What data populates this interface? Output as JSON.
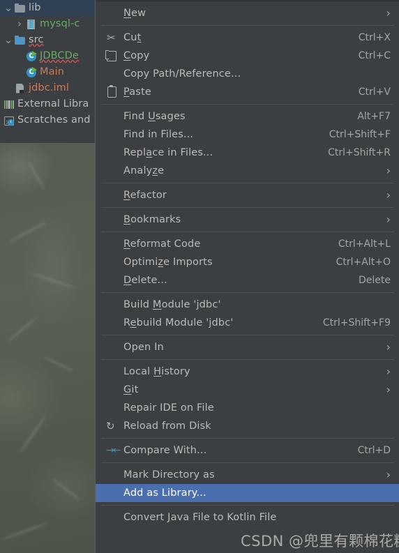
{
  "colors": {
    "menu_bg": "#3c3f41",
    "menu_text": "#bbbbbb",
    "highlight": "#4b6eaf",
    "tree_selection": "#2f4153",
    "separator": "#4e5254",
    "accent_blue": "#3592c4",
    "run_green": "#62b543",
    "error_red": "#c75450"
  },
  "tree": {
    "items": [
      {
        "label": "lib",
        "icon": "folder-gray-icon",
        "arrow": "chevron-down",
        "indent": 0,
        "selected": true,
        "color": "#bbbbbb",
        "wavy": false
      },
      {
        "label": "mysql-c",
        "icon": "jar-icon",
        "arrow": "chevron-right",
        "indent": 1,
        "selected": false,
        "color": "#6aaa64",
        "wavy": false
      },
      {
        "label": "src",
        "icon": "folder-blue-icon",
        "arrow": "chevron-down",
        "indent": 0,
        "selected": false,
        "color": "#bbbbbb",
        "wavy": true
      },
      {
        "label": "JDBCDe",
        "icon": "java-class-run-icon",
        "arrow": "none",
        "indent": 1,
        "selected": false,
        "color": "#6aaa64",
        "wavy": true
      },
      {
        "label": "Main",
        "icon": "java-class-run-icon",
        "arrow": "none",
        "indent": 1,
        "selected": false,
        "color": "#c87b5a",
        "wavy": false
      },
      {
        "label": "jdbc.iml",
        "icon": "iml-file-icon",
        "arrow": "none",
        "indent": 0,
        "selected": false,
        "color": "#c87b5a",
        "wavy": false
      },
      {
        "label": "External Libra",
        "icon": "external-libraries-icon",
        "arrow": "none",
        "indent": -1,
        "selected": false,
        "color": "#bbbbbb",
        "wavy": false
      },
      {
        "label": "Scratches and",
        "icon": "scratches-icon",
        "arrow": "none",
        "indent": -1,
        "selected": false,
        "color": "#bbbbbb",
        "wavy": false
      }
    ]
  },
  "context_menu": {
    "groups": [
      {
        "items": [
          {
            "label": "New",
            "mnemonic": "N",
            "shortcut": "",
            "submenu": true,
            "icon": "",
            "highlighted": false
          }
        ]
      },
      {
        "items": [
          {
            "label": "Cut",
            "mnemonic": "t",
            "shortcut": "Ctrl+X",
            "submenu": false,
            "icon": "cut-icon",
            "highlighted": false
          },
          {
            "label": "Copy",
            "mnemonic": "C",
            "shortcut": "Ctrl+C",
            "submenu": false,
            "icon": "copy-icon",
            "highlighted": false
          },
          {
            "label": "Copy Path/Reference...",
            "mnemonic": "",
            "shortcut": "",
            "submenu": false,
            "icon": "",
            "highlighted": false
          },
          {
            "label": "Paste",
            "mnemonic": "P",
            "shortcut": "Ctrl+V",
            "submenu": false,
            "icon": "paste-icon",
            "highlighted": false
          }
        ]
      },
      {
        "items": [
          {
            "label": "Find Usages",
            "mnemonic": "U",
            "shortcut": "Alt+F7",
            "submenu": false,
            "icon": "",
            "highlighted": false
          },
          {
            "label": "Find in Files...",
            "mnemonic": "",
            "shortcut": "Ctrl+Shift+F",
            "submenu": false,
            "icon": "",
            "highlighted": false
          },
          {
            "label": "Replace in Files...",
            "mnemonic": "a",
            "shortcut": "Ctrl+Shift+R",
            "submenu": false,
            "icon": "",
            "highlighted": false
          },
          {
            "label": "Analyze",
            "mnemonic": "z",
            "shortcut": "",
            "submenu": true,
            "icon": "",
            "highlighted": false
          }
        ]
      },
      {
        "items": [
          {
            "label": "Refactor",
            "mnemonic": "R",
            "shortcut": "",
            "submenu": true,
            "icon": "",
            "highlighted": false
          }
        ]
      },
      {
        "items": [
          {
            "label": "Bookmarks",
            "mnemonic": "B",
            "shortcut": "",
            "submenu": true,
            "icon": "",
            "highlighted": false
          }
        ]
      },
      {
        "items": [
          {
            "label": "Reformat Code",
            "mnemonic": "R",
            "shortcut": "Ctrl+Alt+L",
            "submenu": false,
            "icon": "",
            "highlighted": false
          },
          {
            "label": "Optimize Imports",
            "mnemonic": "z",
            "shortcut": "Ctrl+Alt+O",
            "submenu": false,
            "icon": "",
            "highlighted": false
          },
          {
            "label": "Delete...",
            "mnemonic": "D",
            "shortcut": "Delete",
            "submenu": false,
            "icon": "",
            "highlighted": false
          }
        ]
      },
      {
        "items": [
          {
            "label": "Build Module 'jdbc'",
            "mnemonic": "M",
            "shortcut": "",
            "submenu": false,
            "icon": "",
            "highlighted": false
          },
          {
            "label": "Rebuild Module 'jdbc'",
            "mnemonic": "e",
            "shortcut": "Ctrl+Shift+F9",
            "submenu": false,
            "icon": "",
            "highlighted": false
          }
        ]
      },
      {
        "items": [
          {
            "label": "Open In",
            "mnemonic": "",
            "shortcut": "",
            "submenu": true,
            "icon": "",
            "highlighted": false
          }
        ]
      },
      {
        "items": [
          {
            "label": "Local History",
            "mnemonic": "H",
            "shortcut": "",
            "submenu": true,
            "icon": "",
            "highlighted": false
          },
          {
            "label": "Git",
            "mnemonic": "G",
            "shortcut": "",
            "submenu": true,
            "icon": "",
            "highlighted": false
          },
          {
            "label": "Repair IDE on File",
            "mnemonic": "",
            "shortcut": "",
            "submenu": false,
            "icon": "",
            "highlighted": false
          },
          {
            "label": "Reload from Disk",
            "mnemonic": "",
            "shortcut": "",
            "submenu": false,
            "icon": "reload-icon",
            "highlighted": false
          }
        ]
      },
      {
        "items": [
          {
            "label": "Compare With...",
            "mnemonic": "",
            "shortcut": "Ctrl+D",
            "submenu": false,
            "icon": "compare-icon",
            "highlighted": false
          }
        ]
      },
      {
        "items": [
          {
            "label": "Mark Directory as",
            "mnemonic": "",
            "shortcut": "",
            "submenu": true,
            "icon": "",
            "highlighted": false
          },
          {
            "label": "Add as Library...",
            "mnemonic": "",
            "shortcut": "",
            "submenu": false,
            "icon": "",
            "highlighted": true
          }
        ]
      },
      {
        "items": [
          {
            "label": "Convert Java File to Kotlin File",
            "mnemonic": "",
            "shortcut": "",
            "submenu": false,
            "icon": "",
            "highlighted": false
          }
        ]
      }
    ]
  },
  "watermark": {
    "text": "CSDN @兜里有颗棉花糖"
  }
}
